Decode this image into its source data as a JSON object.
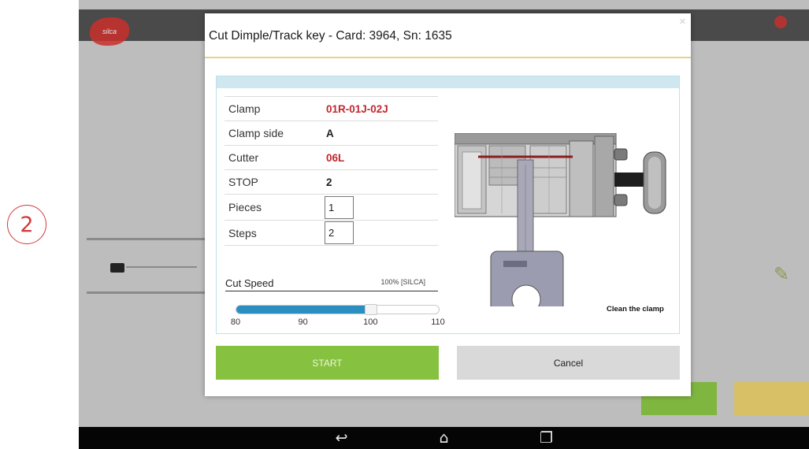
{
  "step_marker": "2",
  "dialog": {
    "title": "Cut Dimple/Track key - Card: 3964, Sn: 1635",
    "params": [
      {
        "label": "Clamp",
        "value": "01R-01J-02J",
        "color": "#c1272d"
      },
      {
        "label": "Clamp side",
        "value": "A",
        "color": "#222222"
      },
      {
        "label": "Cutter",
        "value": "06L",
        "color": "#c1272d"
      },
      {
        "label": "STOP",
        "value": "2",
        "color": "#222222"
      }
    ],
    "pieces": {
      "label": "Pieces",
      "value": "1"
    },
    "steps": {
      "label": "Steps",
      "value": "2"
    },
    "speed": {
      "label": "Cut Speed",
      "value_text": "100% [SILCA]",
      "value": 100,
      "min": 80,
      "max": 110,
      "ticks": [
        "80",
        "90",
        "100",
        "110"
      ]
    },
    "image_caption": "Clean the clamp",
    "start_label": "START",
    "cancel_label": "Cancel"
  },
  "colors": {
    "accent_blue": "#2a8fc0",
    "start_green": "#86c140",
    "brand_red": "#c1272d"
  },
  "navbar": {
    "back_icon": "back-icon",
    "home_icon": "home-icon",
    "recents_icon": "recents-icon"
  }
}
